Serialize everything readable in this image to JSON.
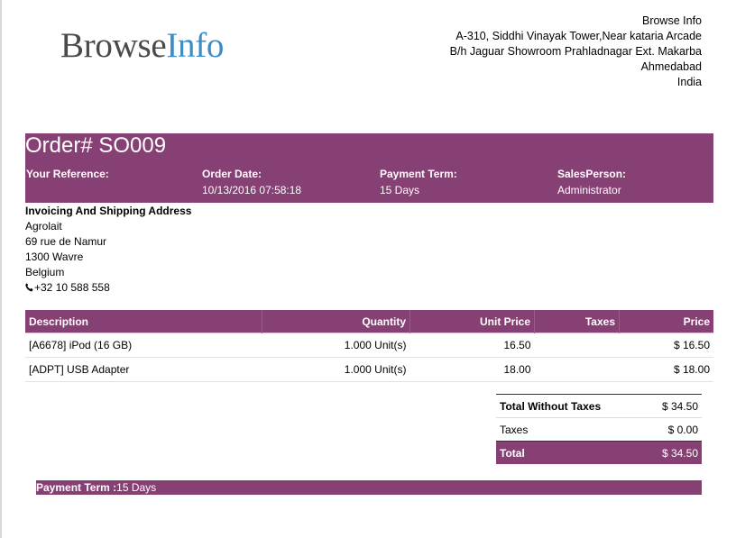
{
  "logo": {
    "part1": "Browse",
    "part2": "Info"
  },
  "company": {
    "name": "Browse Info",
    "address1": "A-310, Siddhi Vinayak Tower,Near kataria Arcade",
    "address2": "B/h Jaguar Showroom Prahladnagar Ext. Makarba",
    "city": "Ahmedabad",
    "country": "India"
  },
  "order": {
    "title": "Order# SO009",
    "reference": {
      "label": "Your Reference:",
      "value": ""
    },
    "date": {
      "label": "Order Date:",
      "value": "10/13/2016 07:58:18"
    },
    "payment_term": {
      "label": "Payment Term:",
      "value": "15 Days"
    },
    "salesperson": {
      "label": "SalesPerson:",
      "value": "Administrator"
    }
  },
  "address": {
    "heading": "Invoicing And Shipping Address",
    "name": "Agrolait",
    "street": "69 rue de Namur",
    "city": "1300 Wavre",
    "country": "Belgium",
    "phone": "+32 10 588 558",
    "phone_icon": "phone-icon"
  },
  "lines": {
    "headers": {
      "description": "Description",
      "quantity": "Quantity",
      "unit_price": "Unit Price",
      "taxes": "Taxes",
      "price": "Price"
    },
    "rows": [
      {
        "description": "[A6678] iPod (16 GB)",
        "quantity": "1.000 Unit(s)",
        "unit_price": "16.50",
        "taxes": "",
        "price": "$ 16.50"
      },
      {
        "description": "[ADPT] USB Adapter",
        "quantity": "1.000 Unit(s)",
        "unit_price": "18.00",
        "taxes": "",
        "price": "$ 18.00"
      }
    ]
  },
  "totals": {
    "untaxed_label": "Total Without Taxes",
    "untaxed_value": "$ 34.50",
    "taxes_label": "Taxes",
    "taxes_value": "$ 0.00",
    "total_label": "Total",
    "total_value": "$ 34.50"
  },
  "footer": {
    "payment_term_label": "Payment Term :",
    "payment_term_value": "15 Days"
  },
  "colors": {
    "accent": "#874073",
    "logo_blue": "#3b8dc8",
    "logo_gray": "#4a4a4a"
  }
}
